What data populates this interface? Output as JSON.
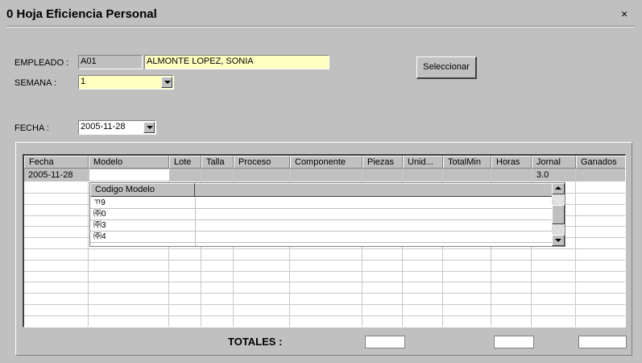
{
  "window": {
    "title": "0 Hoja Eficiencia Personal",
    "close_glyph": "×"
  },
  "form": {
    "empleado_label": "EMPLEADO :",
    "empleado_code": "A01",
    "empleado_name": "ALMONTE LOPEZ, SONIA",
    "semana_label": "SEMANA :",
    "semana_value": "1",
    "fecha_label": "FECHA :",
    "fecha_value": "2005-11-28",
    "select_button": "Seleccionar"
  },
  "grid": {
    "columns": [
      "Fecha",
      "Modelo",
      "Lote",
      "Talla",
      "Proceso",
      "Componente",
      "Piezas",
      "Unid...",
      "TotalMin",
      "Horas",
      "Jornal",
      "Ganados"
    ],
    "rows": [
      {
        "fecha": "2005-11-28",
        "jornal": "3.0"
      }
    ]
  },
  "dropdown": {
    "header": "Codigo Modelo",
    "items": [
      "ㄲ9",
      "㈜0",
      "㈜3",
      "㈜4"
    ]
  },
  "totals": {
    "label": "TOTALES :"
  }
}
